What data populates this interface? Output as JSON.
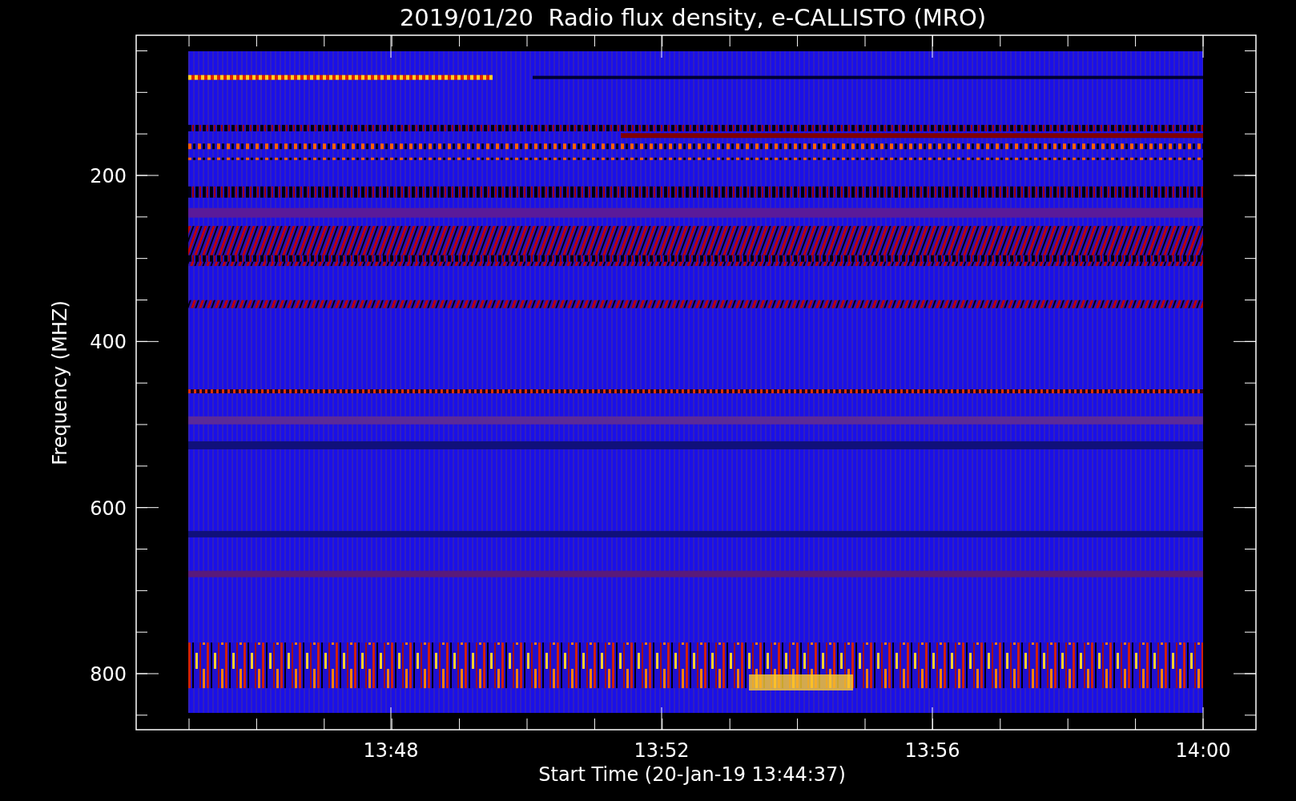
{
  "title": "2019/01/20  Radio flux density, e-CALLISTO (MRO)",
  "y_axis": {
    "label": "Frequency (MHZ)",
    "ticks": [
      "200",
      "400",
      "600",
      "800"
    ]
  },
  "x_axis": {
    "label": "Start Time (20-Jan-19 13:44:37)",
    "ticks": [
      "13:48",
      "13:52",
      "13:56",
      "14:00"
    ]
  }
}
